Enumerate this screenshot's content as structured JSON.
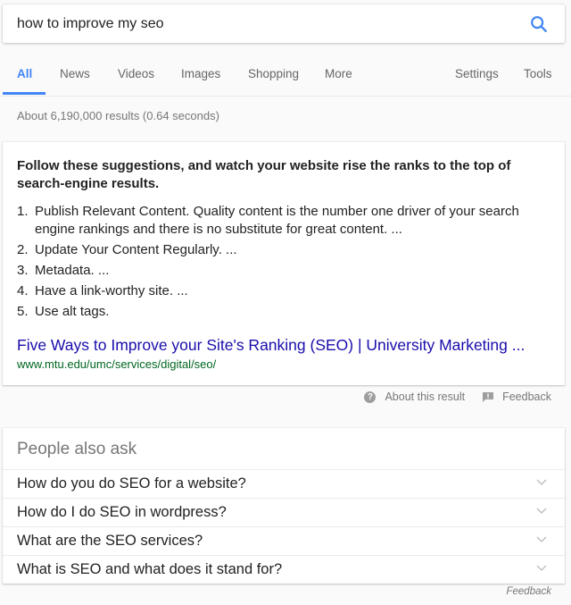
{
  "search": {
    "query": "how to improve my seo",
    "icon": "search-icon"
  },
  "tabs": [
    {
      "label": "All",
      "active": true
    },
    {
      "label": "News",
      "active": false
    },
    {
      "label": "Videos",
      "active": false
    },
    {
      "label": "Images",
      "active": false
    },
    {
      "label": "Shopping",
      "active": false
    },
    {
      "label": "More",
      "active": false
    }
  ],
  "tools": {
    "settings": "Settings",
    "tools": "Tools"
  },
  "result_stats": "About 6,190,000 results (0.64 seconds)",
  "featured_snippet": {
    "heading": "Follow these suggestions, and watch your website rise the ranks to the top of search-engine results.",
    "items": [
      {
        "num": "1.",
        "text": "Publish Relevant Content. Quality content is the number one driver of your search engine rankings and there is no substitute for great content. ..."
      },
      {
        "num": "2.",
        "text": "Update Your Content Regularly. ..."
      },
      {
        "num": "3.",
        "text": "Metadata. ..."
      },
      {
        "num": "4.",
        "text": "Have a link-worthy site. ..."
      },
      {
        "num": "5.",
        "text": "Use alt tags."
      }
    ],
    "title": "Five Ways to Improve your Site's Ranking (SEO) | University Marketing ...",
    "url": "www.mtu.edu/umc/services/digital/seo/"
  },
  "snippet_footer": {
    "about_label": "About this result",
    "feedback_label": "Feedback"
  },
  "people_also_ask": {
    "title": "People also ask",
    "questions": [
      "How do you do SEO for a website?",
      "How do I do SEO in wordpress?",
      "What are the SEO services?",
      "What is SEO and what does it stand for?"
    ],
    "feedback_label": "Feedback"
  },
  "colors": {
    "accent": "#4285f4",
    "link": "#1a0dab",
    "url": "#006621",
    "muted": "#777777"
  }
}
